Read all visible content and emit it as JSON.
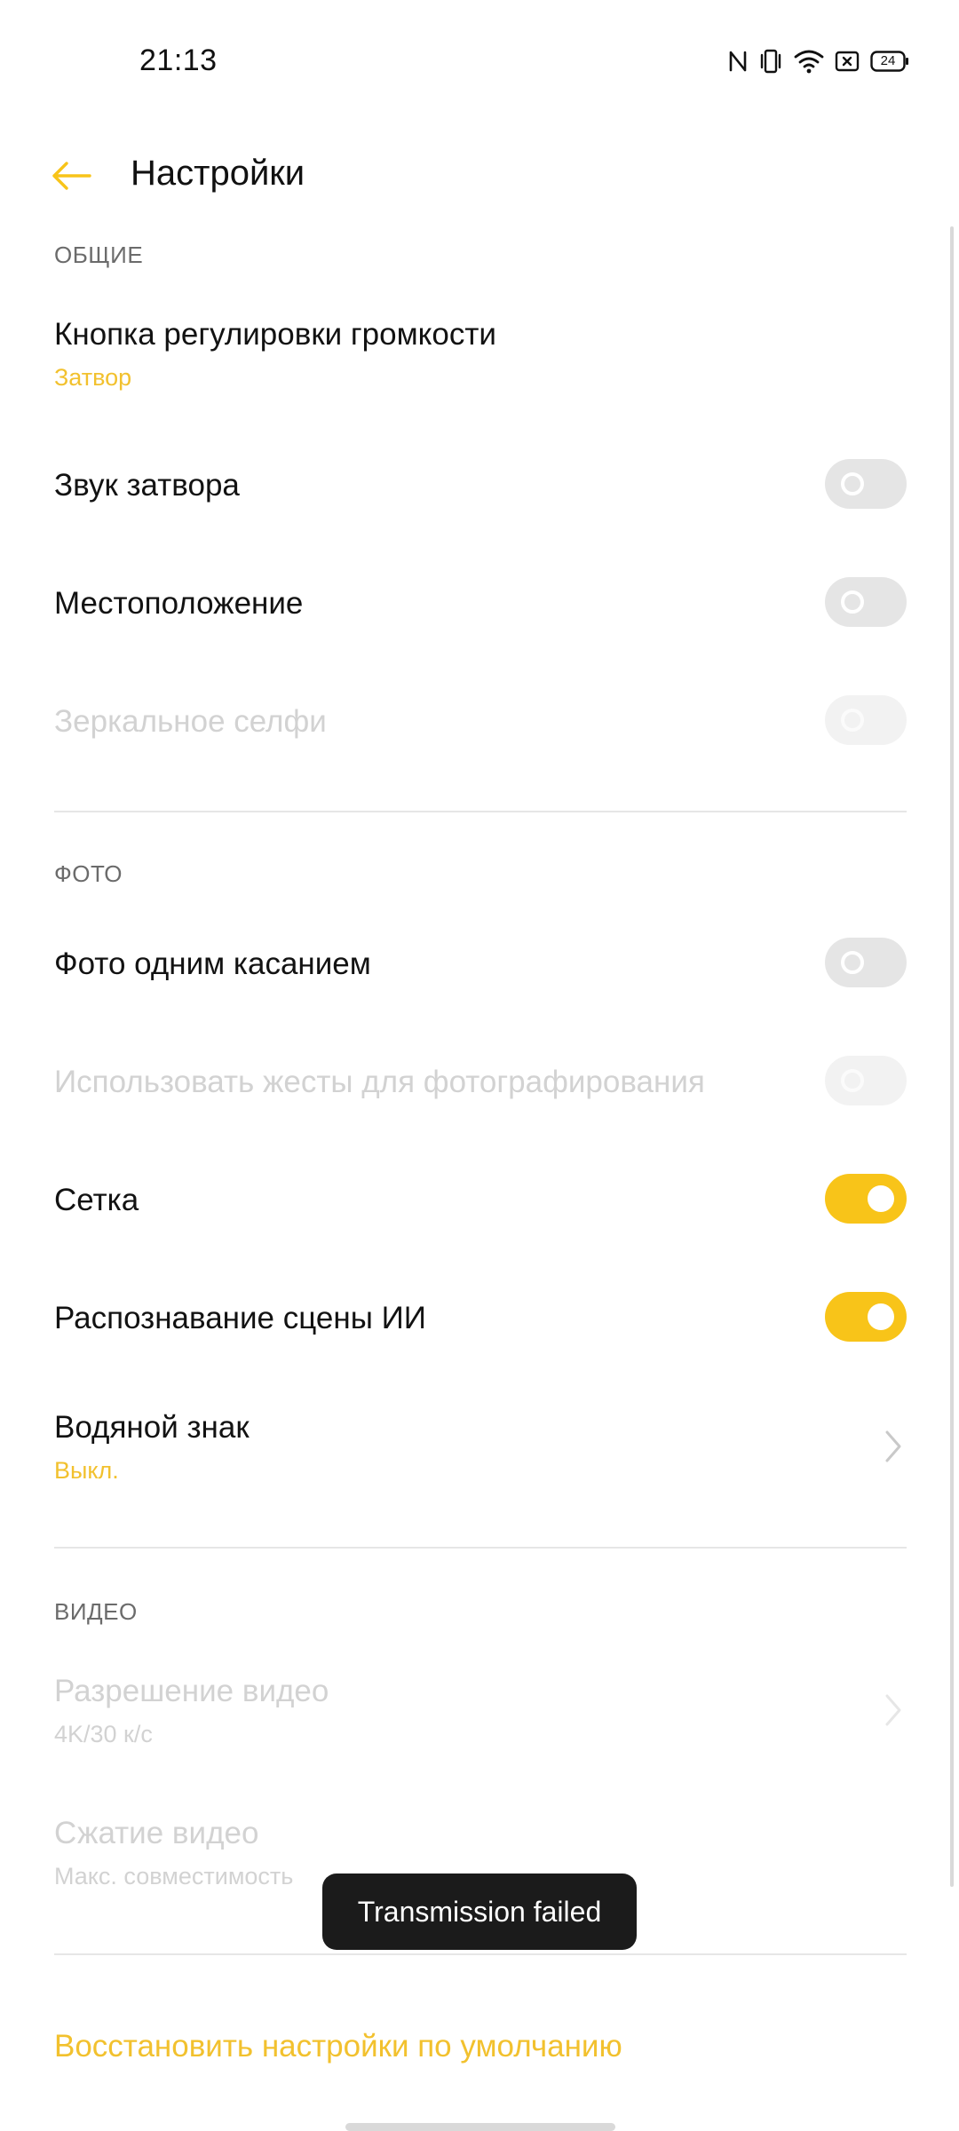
{
  "status_bar": {
    "time": "21:13",
    "battery": "24",
    "icons": [
      "nfc-icon",
      "vibrate-icon",
      "wifi-icon",
      "sim-error-icon",
      "battery-icon"
    ]
  },
  "app_bar": {
    "title": "Настройки",
    "back_icon": "back-arrow-icon"
  },
  "colors": {
    "accent": "#f8c419",
    "accent_text": "#f2c12e",
    "toggle_off": "#e5e5e5",
    "disabled_text": "#d2d2d2"
  },
  "sections": {
    "general": {
      "header": "ОБЩИЕ",
      "volume_button": {
        "title": "Кнопка регулировки громкости",
        "value": "Затвор"
      },
      "shutter_sound": {
        "title": "Звук затвора",
        "enabled": false
      },
      "location": {
        "title": "Местоположение",
        "enabled": false
      },
      "mirror_selfie": {
        "title": "Зеркальное селфи",
        "enabled": false,
        "disabled": true
      }
    },
    "photo": {
      "header": "ФОТО",
      "one_tap_photo": {
        "title": "Фото одним касанием",
        "enabled": false
      },
      "gestures": {
        "title": "Использовать жесты для фотографирования",
        "enabled": false,
        "disabled": true
      },
      "grid": {
        "title": "Сетка",
        "enabled": true
      },
      "ai_scene": {
        "title": "Распознавание сцены ИИ",
        "enabled": true
      },
      "watermark": {
        "title": "Водяной знак",
        "value": "Выкл."
      }
    },
    "video": {
      "header": "ВИДЕО",
      "resolution": {
        "title": "Разрешение видео",
        "value": "4K/30 к/с",
        "disabled": true
      },
      "compression": {
        "title": "Сжатие видео",
        "value": "Макс. совместимость",
        "disabled": true
      }
    }
  },
  "toast": {
    "text": "Transmission failed"
  },
  "reset_link": "Восстановить настройки по умолчанию"
}
